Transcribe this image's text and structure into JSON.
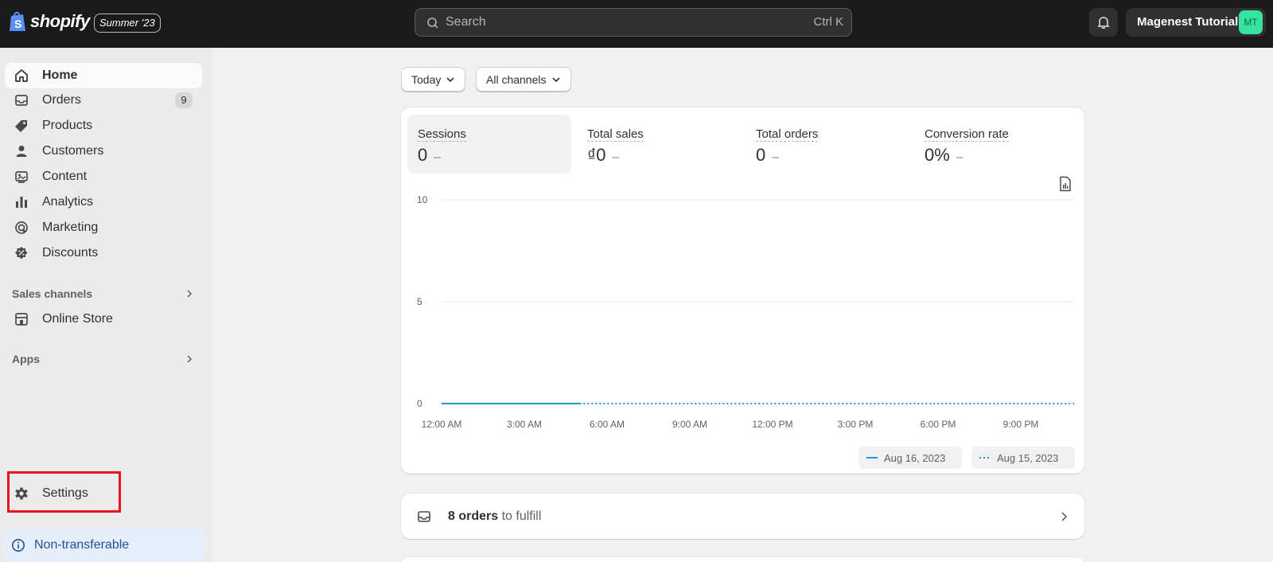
{
  "brand": {
    "name": "shopify",
    "edition": "Summer '23"
  },
  "search": {
    "placeholder": "Search",
    "shortcut": "Ctrl K"
  },
  "account": {
    "name": "Magenest Tutorial",
    "initials": "MT"
  },
  "sidebar": {
    "items": [
      {
        "label": "Home",
        "icon": "home-icon",
        "active": true
      },
      {
        "label": "Orders",
        "icon": "inbox-icon",
        "badge": "9"
      },
      {
        "label": "Products",
        "icon": "tag-icon"
      },
      {
        "label": "Customers",
        "icon": "person-icon"
      },
      {
        "label": "Content",
        "icon": "image-icon"
      },
      {
        "label": "Analytics",
        "icon": "bar-chart-icon"
      },
      {
        "label": "Marketing",
        "icon": "target-icon"
      },
      {
        "label": "Discounts",
        "icon": "discount-icon"
      }
    ],
    "sales_channels": {
      "title": "Sales channels",
      "items": [
        {
          "label": "Online Store",
          "icon": "store-icon"
        }
      ]
    },
    "apps": {
      "title": "Apps"
    },
    "settings_label": "Settings",
    "notice": "Non-transferable"
  },
  "filters": {
    "date": "Today",
    "channel": "All channels"
  },
  "metrics": [
    {
      "label": "Sessions",
      "value": "0",
      "trend": "–",
      "selected": true
    },
    {
      "label": "Total sales",
      "value": "₫0",
      "trend": "–"
    },
    {
      "label": "Total orders",
      "value": "0",
      "trend": "–"
    },
    {
      "label": "Conversion rate",
      "value": "0%",
      "trend": "–"
    }
  ],
  "chart_data": {
    "type": "line",
    "title": "",
    "xlabel": "",
    "ylabel": "",
    "ylim": [
      0,
      10
    ],
    "y_ticks": [
      "10",
      "5",
      "0"
    ],
    "x_ticks": [
      "12:00 AM",
      "3:00 AM",
      "6:00 AM",
      "9:00 AM",
      "12:00 PM",
      "3:00 PM",
      "6:00 PM",
      "9:00 PM"
    ],
    "series": [
      {
        "name": "Aug 16, 2023",
        "style": "solid",
        "color": "#1d9bd1",
        "x": [
          "12:00 AM",
          "5:00 AM"
        ],
        "values": [
          0,
          0
        ]
      },
      {
        "name": "Aug 15, 2023",
        "style": "dotted",
        "color": "#1d9bd1",
        "x": [
          "5:00 AM",
          "11:59 PM"
        ],
        "values": [
          0,
          0
        ]
      }
    ],
    "grid": true,
    "legend": "bottom-right"
  },
  "fulfill": {
    "count": "8 orders",
    "rest": " to fulfill"
  }
}
